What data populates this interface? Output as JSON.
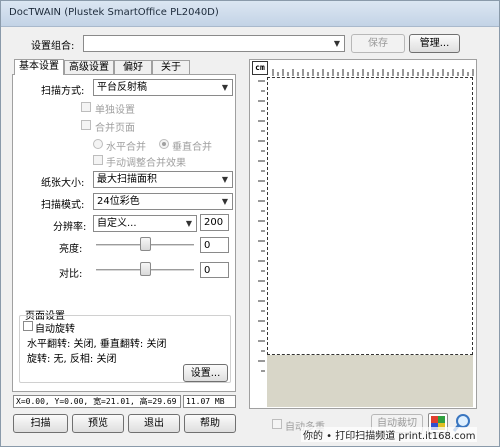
{
  "window": {
    "title": "DocTWAIN (Plustek SmartOffice PL2040D)"
  },
  "settings_combo": {
    "label": "设置组合:",
    "value": "",
    "save": "保存",
    "manage": "管理..."
  },
  "tabs": [
    {
      "label": "基本设置",
      "active": true
    },
    {
      "label": "高级设置",
      "active": false
    },
    {
      "label": "偏好",
      "active": false
    },
    {
      "label": "关于",
      "active": false
    }
  ],
  "basic": {
    "scan_mode_label": "扫描方式:",
    "scan_mode_value": "平台反射稿",
    "single_label": "单独设置",
    "merge_page_label": "合并页面",
    "horizontal_merge": "水平合并",
    "vertical_merge": "垂直合并",
    "manual_merge": "手动调整合并效果",
    "paper_size_label": "纸张大小:",
    "paper_size_value": "最大扫描面积",
    "scan_type_label": "扫描模式:",
    "scan_type_value": "24位彩色",
    "resolution_label": "分辨率:",
    "resolution_mode": "自定义...",
    "resolution_value": "200",
    "brightness_label": "亮度:",
    "brightness_value": "0",
    "brightness_level": 0.5,
    "contrast_label": "对比:",
    "contrast_value": "0",
    "contrast_level": 0.5
  },
  "page_settings": {
    "title": "页面设置",
    "auto_rotate": "自动旋转",
    "flip_line": "水平翻转: 关闭,  垂直翻转: 关闭",
    "rotate_line": "旋转: 无,  反相: 关闭",
    "settings_button": "设置..."
  },
  "status": {
    "coords": "X=0.00, Y=0.00, 宽=21.01, 高=29.69",
    "size": "11.07 MB"
  },
  "buttons": {
    "scan": "扫描",
    "preview": "预览",
    "exit": "退出",
    "help": "帮助"
  },
  "preview": {
    "unit": "cm",
    "auto_multi": "自动多重",
    "auto_crop": "自动裁切",
    "unscanned_color": "#d8d6c8"
  },
  "watermark": "你的 • 打印扫描频道   print.it168.com"
}
